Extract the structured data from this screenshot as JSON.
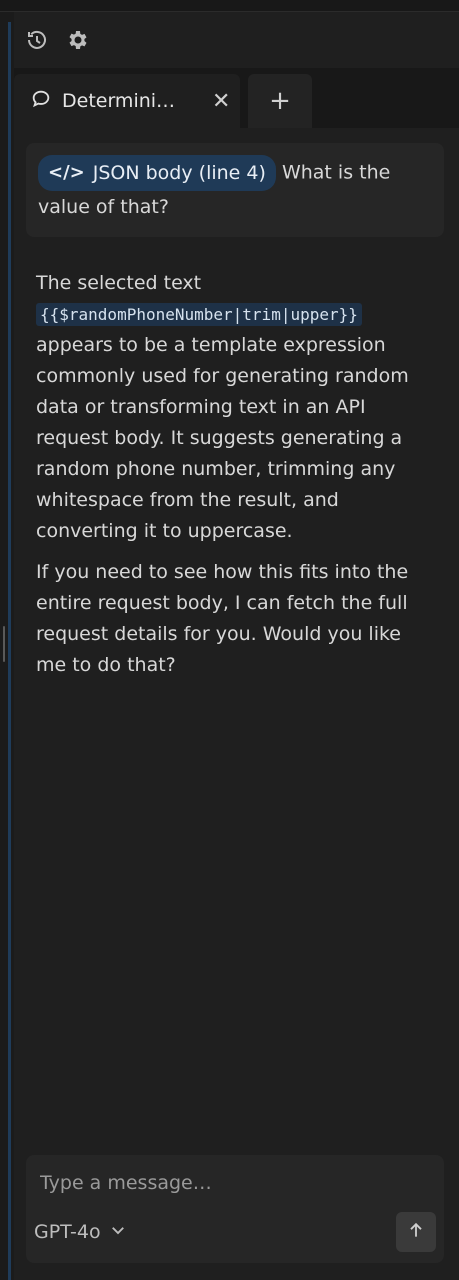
{
  "toolbar": {
    "history_icon": "history-icon",
    "settings_icon": "gear-icon"
  },
  "tabs": [
    {
      "icon": "chat-bubble-icon",
      "label": "Determini…"
    },
    {
      "icon": "plus-icon",
      "label": "+"
    }
  ],
  "user_message": {
    "chip_label": "JSON body (line 4)",
    "chip_icon": "code-icon",
    "text": "What is the value of that?"
  },
  "assistant": {
    "p1_intro": "The selected text",
    "code": "{{$randomPhoneNumber|trim|upper}}",
    "p1_rest": "appears to be a template expression commonly used for generating random data or transforming text in an API request body. It suggests generating a random phone number, trimming any whitespace from the result, and converting it to uppercase.",
    "p2": "If you need to see how this fits into the entire request body, I can fetch the full request details for you. Would you like me to do that?"
  },
  "composer": {
    "placeholder": "Type a message…",
    "model": "GPT-4o",
    "send_icon": "arrow-up-icon"
  },
  "colors": {
    "background": "#1f1f1f",
    "chip": "#1f3a57",
    "code_bg": "#1e3147",
    "accent_rail": "#1f3c5a"
  }
}
